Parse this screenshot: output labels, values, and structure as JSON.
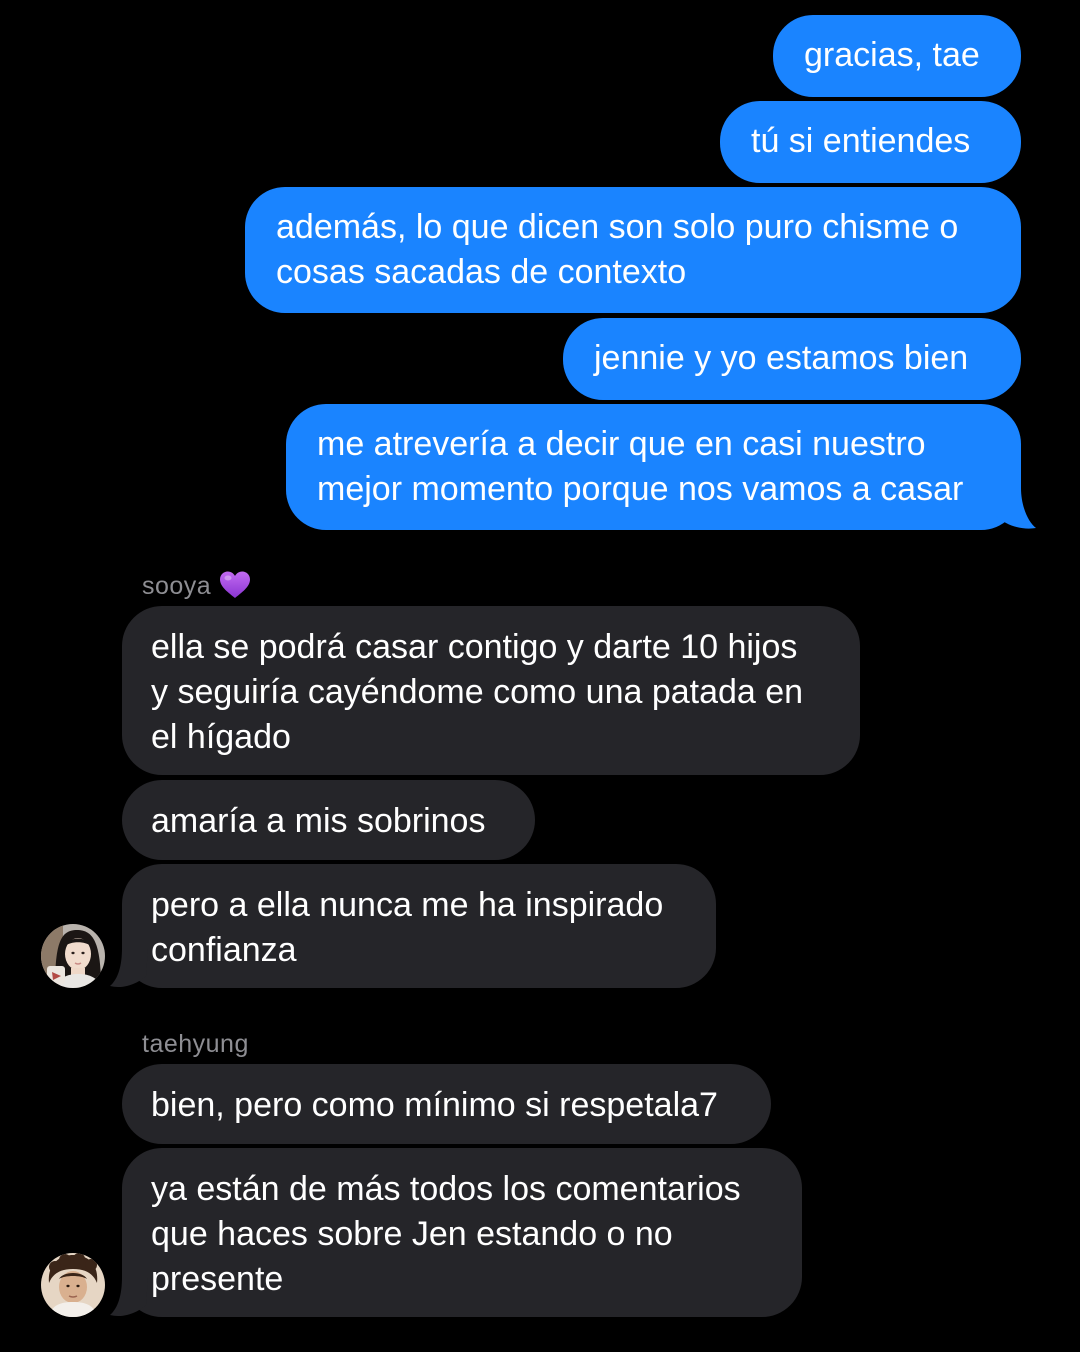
{
  "colors": {
    "background": "#000000",
    "sent_bubble": "#1a84ff",
    "received_bubble": "#252529",
    "sender_name": "#8e8e93",
    "text": "#ffffff",
    "heart": "#a34be0"
  },
  "sent_messages": [
    {
      "lines": [
        "gracias, tae"
      ]
    },
    {
      "lines": [
        "tú si entiendes"
      ]
    },
    {
      "lines": [
        "además, lo que dicen son solo puro chisme o",
        "cosas sacadas de contexto"
      ]
    },
    {
      "lines": [
        "jennie y yo estamos bien"
      ]
    },
    {
      "lines": [
        "me atrevería a decir que en casi nuestro",
        "mejor momento porque nos vamos a casar"
      ]
    }
  ],
  "groups": [
    {
      "sender": "sooya",
      "sender_icon": "purple-heart-icon",
      "avatar_icon": "avatar-sooya",
      "messages": [
        {
          "lines": [
            "ella se podrá casar contigo y darte 10 hijos",
            "y seguiría cayéndome como una patada en",
            "el hígado"
          ]
        },
        {
          "lines": [
            "amaría a mis sobrinos"
          ]
        },
        {
          "lines": [
            "pero a ella nunca me ha inspirado",
            "confianza"
          ]
        }
      ]
    },
    {
      "sender": "taehyung",
      "avatar_icon": "avatar-taehyung",
      "messages": [
        {
          "lines": [
            "bien, pero como mínimo si respetala7"
          ]
        },
        {
          "lines": [
            "ya están de más todos los comentarios",
            "que haces sobre Jen estando o no",
            "presente"
          ]
        }
      ]
    }
  ]
}
